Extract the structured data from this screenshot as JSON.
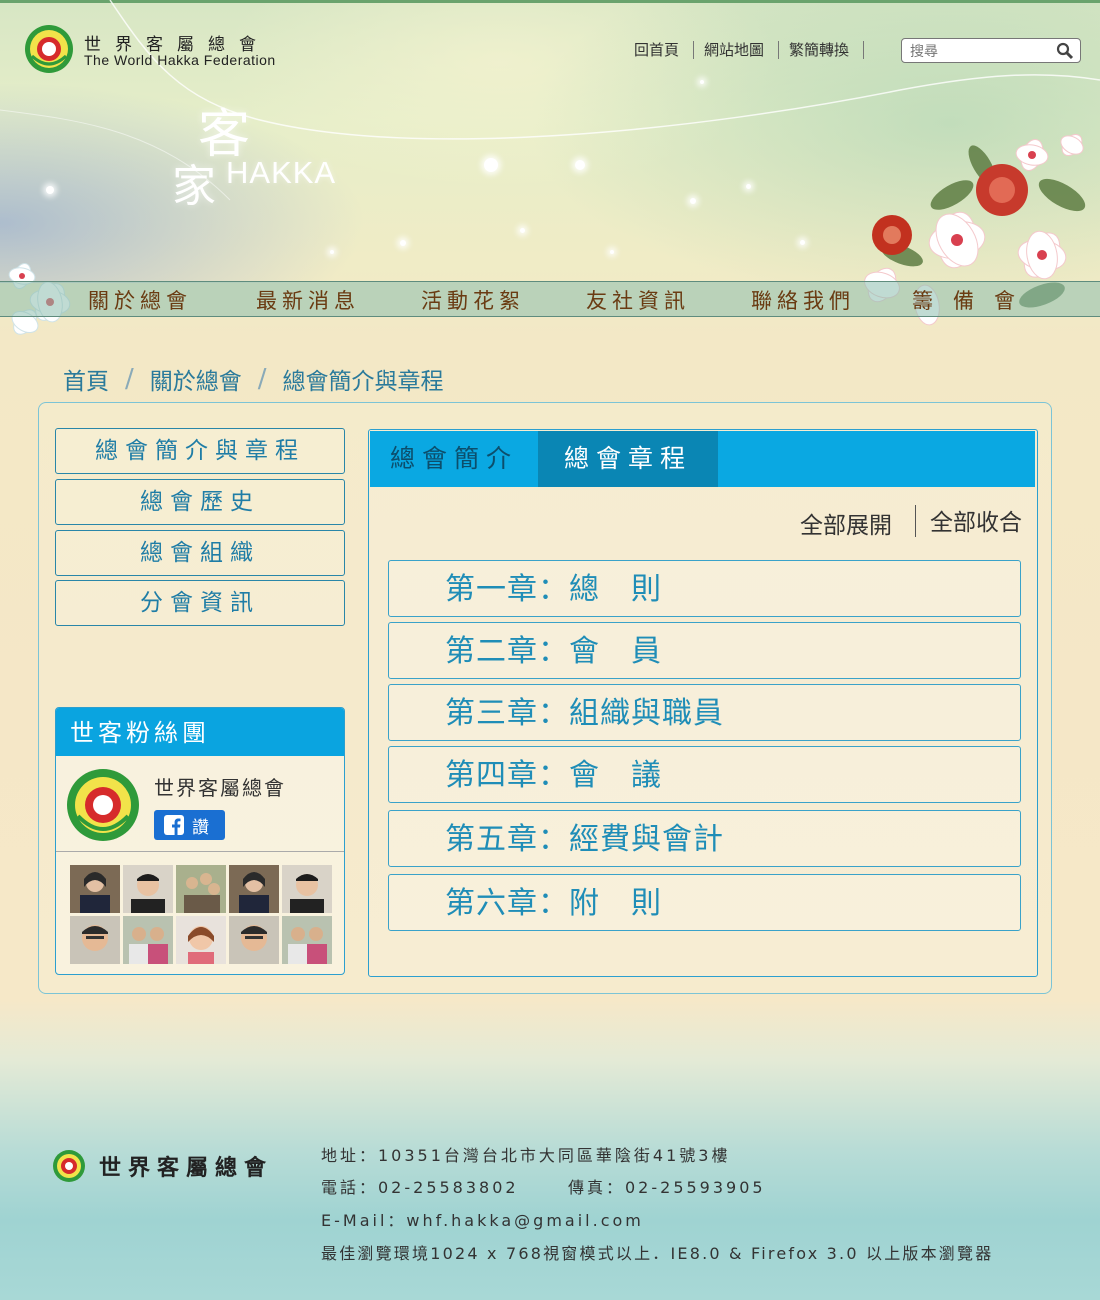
{
  "header": {
    "org_name_cn": "世界客屬總會",
    "org_name_en": "The World Hakka Federation",
    "banner_hakka_cn_1": "客",
    "banner_hakka_cn_2": "家",
    "banner_hakka_en": "HAKKA",
    "links": [
      "回首頁",
      "網站地圖",
      "繁簡轉換"
    ],
    "search_placeholder": "搜尋"
  },
  "nav": [
    "關於總會",
    "最新消息",
    "活動花絮",
    "友社資訊",
    "聯絡我們",
    "籌備會"
  ],
  "breadcrumb": [
    "首頁",
    "關於總會",
    "總會簡介與章程"
  ],
  "sidebar": {
    "menu": [
      "總會簡介與章程",
      "總會歷史",
      "總會組織",
      "分會資訊"
    ],
    "fans": {
      "title": "世客粉絲團",
      "page_name": "世界客屬總會",
      "like_label": "讚"
    }
  },
  "content": {
    "tabs": [
      "總會簡介",
      "總會章程"
    ],
    "active_tab": "總會章程",
    "expand_all": "全部展開",
    "collapse_all": "全部收合",
    "chapters": [
      "第一章：總　則",
      "第二章：會　員",
      "第三章：組織與職員",
      "第四章：會　議",
      "第五章：經費與會計",
      "第六章：附　則"
    ]
  },
  "footer": {
    "org_name": "世界客屬總會",
    "address": "地址：10351台灣台北市大同區華陰街41號3樓",
    "phone": "電話：02-25583802",
    "fax": "傳真：02-25593905",
    "email": "E-Mail：whf.hakka@gmail.com",
    "browser_note": "最佳瀏覽環境1024 x 768視窗模式以上．IE8.0 & Firefox 3.0 以上版本瀏覽器"
  },
  "colors": {
    "accent_blue": "#0aa8e2",
    "active_tab": "#0a86b4",
    "nav_text": "#6a3b12",
    "link_blue": "#1f7da6"
  }
}
